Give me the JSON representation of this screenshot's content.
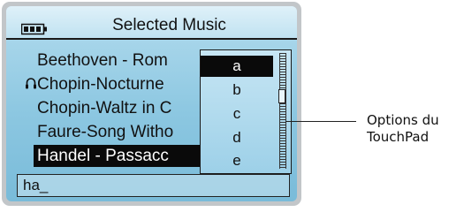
{
  "header": {
    "title": "Selected Music",
    "battery_icon": "battery-icon"
  },
  "tracks": [
    {
      "label": "Beethoven - Rom",
      "playing": false,
      "selected": false
    },
    {
      "label": "Chopin-Nocturne",
      "playing": true,
      "selected": false
    },
    {
      "label": "Chopin-Waltz in C",
      "playing": false,
      "selected": false
    },
    {
      "label": "Faure-Song Witho",
      "playing": false,
      "selected": false
    },
    {
      "label": "Handel - Passacc",
      "playing": false,
      "selected": true
    }
  ],
  "search": {
    "value": "ha_"
  },
  "options": {
    "letters": [
      "a",
      "b",
      "c",
      "d",
      "e"
    ],
    "selected_index": 0
  },
  "callout": {
    "line1": "Options du",
    "line2": "TouchPad"
  },
  "colors": {
    "screen": "#8cc7e1",
    "selection": "#0a0a0a",
    "device": "#c2c6c9"
  }
}
